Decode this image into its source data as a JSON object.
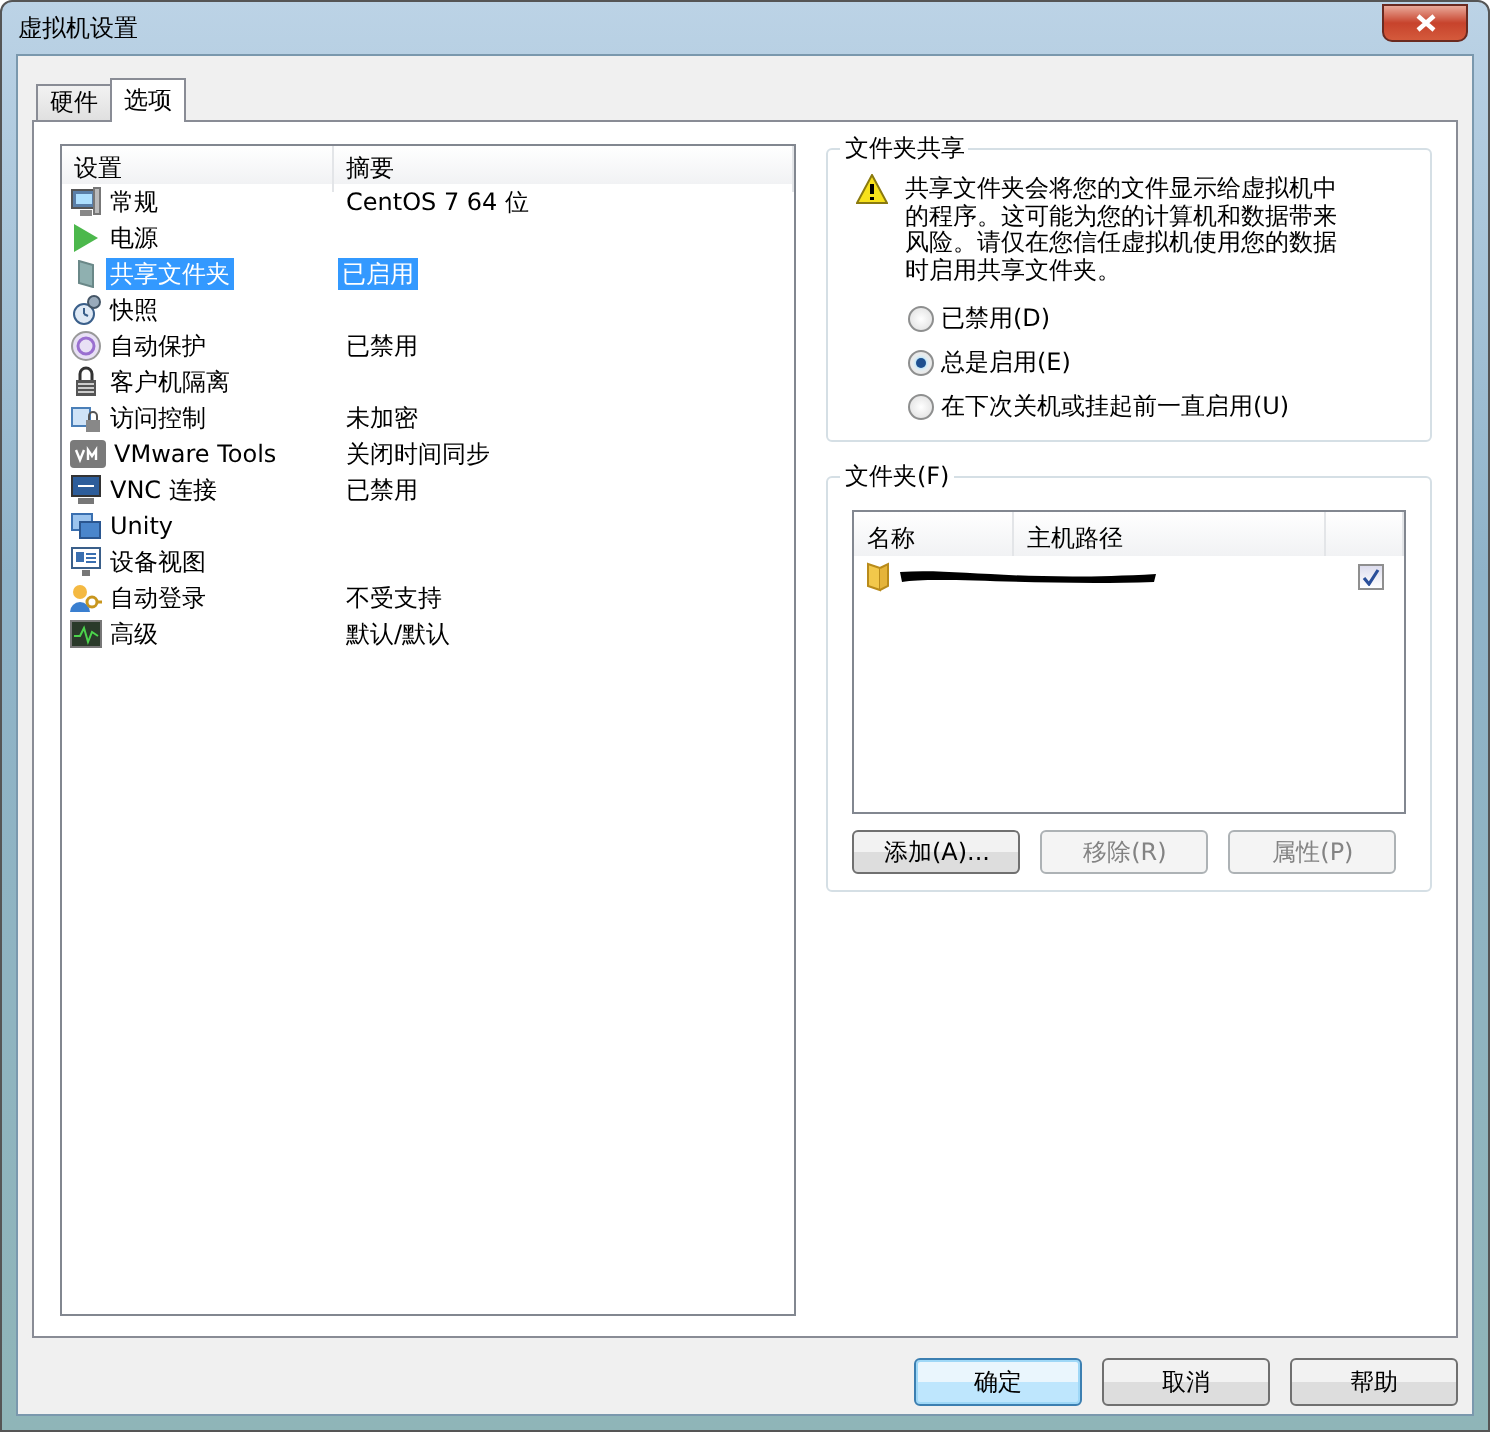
{
  "window": {
    "title": "虚拟机设置"
  },
  "tabs": [
    {
      "label": "硬件",
      "selected": false
    },
    {
      "label": "选项",
      "selected": true
    }
  ],
  "settings": {
    "columns": [
      "设置",
      "摘要"
    ],
    "rows": [
      {
        "name": "常规",
        "summary": "CentOS 7 64 位",
        "selected": false
      },
      {
        "name": "电源",
        "selected": false
      },
      {
        "name": "共享文件夹",
        "summary": "已启用",
        "selected": true
      },
      {
        "name": "快照",
        "selected": false
      },
      {
        "name": "自动保护",
        "summary": "已禁用",
        "selected": false
      },
      {
        "name": "客户机隔离",
        "selected": false
      },
      {
        "name": "访问控制",
        "summary": "未加密",
        "selected": false
      },
      {
        "name": "VMware Tools",
        "summary": "关闭时间同步",
        "selected": false
      },
      {
        "name": "VNC 连接",
        "summary": "已禁用",
        "selected": false
      },
      {
        "name": "Unity",
        "selected": false
      },
      {
        "name": "设备视图",
        "selected": false
      },
      {
        "name": "自动登录",
        "summary": "不受支持",
        "selected": false
      },
      {
        "name": "高级",
        "summary": "默认/默认",
        "selected": false
      }
    ]
  },
  "sharing": {
    "title": "文件夹共享",
    "warning": "共享文件夹会将您的文件显示给虚拟机中的程序。这可能为您的计算机和数据带来风险。请仅在您信任虚拟机使用您的数据时启用共享文件夹。",
    "options": [
      {
        "label": "已禁用(D)",
        "selected": false
      },
      {
        "label": "总是启用(E)",
        "selected": true
      },
      {
        "label": "在下次关机或挂起前一直启用(U)",
        "selected": false
      }
    ]
  },
  "folders": {
    "title": "文件夹(F)",
    "columns": [
      "名称",
      "主机路径"
    ],
    "rows": [
      {
        "checked": true
      }
    ],
    "buttons": [
      {
        "label": "添加(A)...",
        "disabled": false
      },
      {
        "label": "移除(R)",
        "disabled": true
      },
      {
        "label": "属性(P)",
        "disabled": true
      }
    ]
  },
  "buttons": [
    {
      "label": "确定",
      "default": true
    },
    {
      "label": "取消",
      "default": false
    },
    {
      "label": "帮助",
      "default": false
    }
  ]
}
